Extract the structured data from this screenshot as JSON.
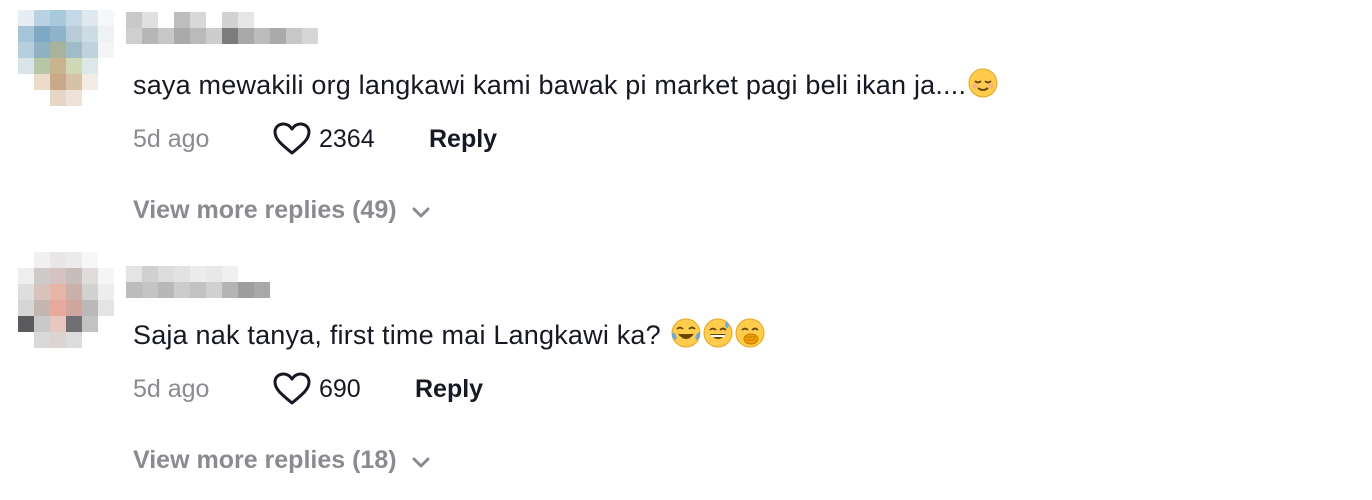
{
  "comments": [
    {
      "text": "saya mewakili org langkawi kami bawak pi market pagi beli ikan ja....",
      "emojis": [
        "relieved-face"
      ],
      "time": "5d ago",
      "likes": "2364",
      "reply_label": "Reply",
      "more_replies": "View more replies (49)"
    },
    {
      "text": "Saja nak tanya, first time mai Langkawi ka? ",
      "emojis": [
        "tears-of-joy-face",
        "grinning-sweat-face",
        "hand-over-mouth-face"
      ],
      "time": "5d ago",
      "likes": "690",
      "reply_label": "Reply",
      "more_replies": "View more replies (18)"
    }
  ]
}
